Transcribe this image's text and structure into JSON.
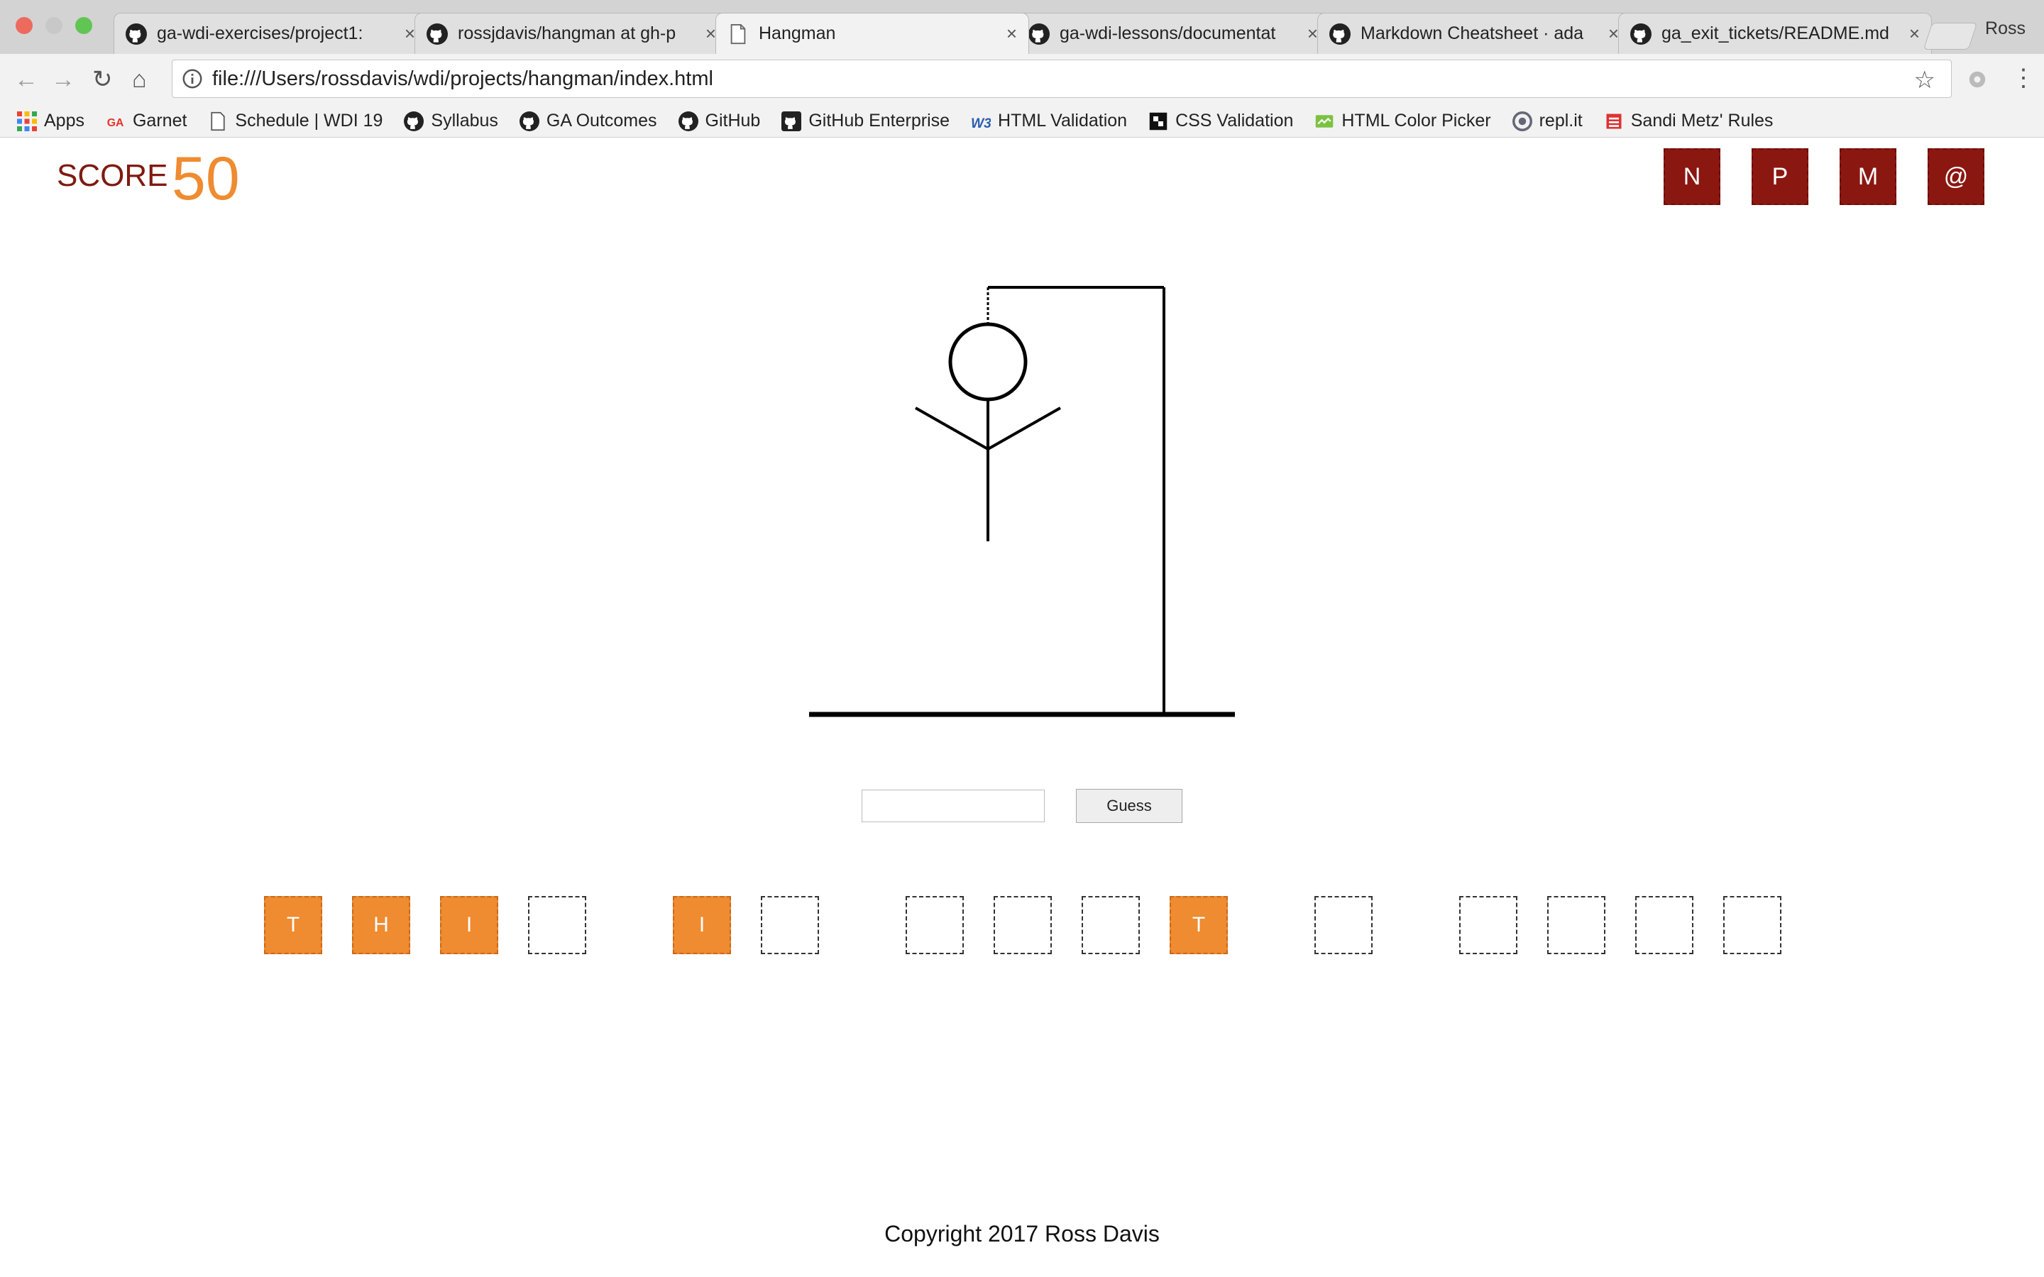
{
  "browser": {
    "tabs": [
      {
        "title": "ga-wdi-exercises/project1: ",
        "icon": "github-icon",
        "active": false
      },
      {
        "title": "rossjdavis/hangman at gh-p",
        "icon": "github-icon",
        "active": false
      },
      {
        "title": "Hangman",
        "icon": "page-icon",
        "active": true
      },
      {
        "title": "ga-wdi-lessons/documentat",
        "icon": "github-icon",
        "active": false
      },
      {
        "title": "Markdown Cheatsheet · ada",
        "icon": "github-icon",
        "active": false
      },
      {
        "title": "ga_exit_tickets/README.md",
        "icon": "github-icon",
        "active": false
      }
    ],
    "close_glyph": "×",
    "profile": "Ross",
    "url": "file:///Users/rossdavis/wdi/projects/hangman/index.html",
    "bookmarks": [
      {
        "label": "Apps",
        "icon": "apps-grid-icon"
      },
      {
        "label": "Garnet",
        "icon": "ga-icon"
      },
      {
        "label": "Schedule | WDI 19",
        "icon": "page-icon"
      },
      {
        "label": "Syllabus",
        "icon": "github-icon"
      },
      {
        "label": "GA Outcomes",
        "icon": "github-icon"
      },
      {
        "label": "GitHub",
        "icon": "github-icon"
      },
      {
        "label": "GitHub Enterprise",
        "icon": "github-icon"
      },
      {
        "label": "HTML Validation",
        "icon": "w3c-icon"
      },
      {
        "label": "CSS Validation",
        "icon": "css-icon"
      },
      {
        "label": "HTML Color Picker",
        "icon": "color-picker-icon"
      },
      {
        "label": "repl.it",
        "icon": "replit-icon"
      },
      {
        "label": "Sandi Metz' Rules",
        "icon": "sandi-icon"
      }
    ]
  },
  "game": {
    "score_label": "SCORE",
    "score_value": "50",
    "nav_tiles": [
      "N",
      "P",
      "M",
      "@"
    ],
    "guess_button_label": "Guess",
    "guess_input_value": "",
    "word_tiles": [
      [
        "T",
        "H",
        "I",
        ""
      ],
      [
        "I",
        ""
      ],
      [
        "",
        "",
        "",
        "T"
      ],
      [
        ""
      ],
      [
        "",
        "",
        "",
        ""
      ]
    ],
    "copyright": "Copyright 2017 Ross Davis"
  },
  "colors": {
    "score_label": "#7f1a10",
    "score_value": "#ef8b30",
    "nav_tile": "#8b1711",
    "letter_tile_filled": "#ef8b30"
  }
}
